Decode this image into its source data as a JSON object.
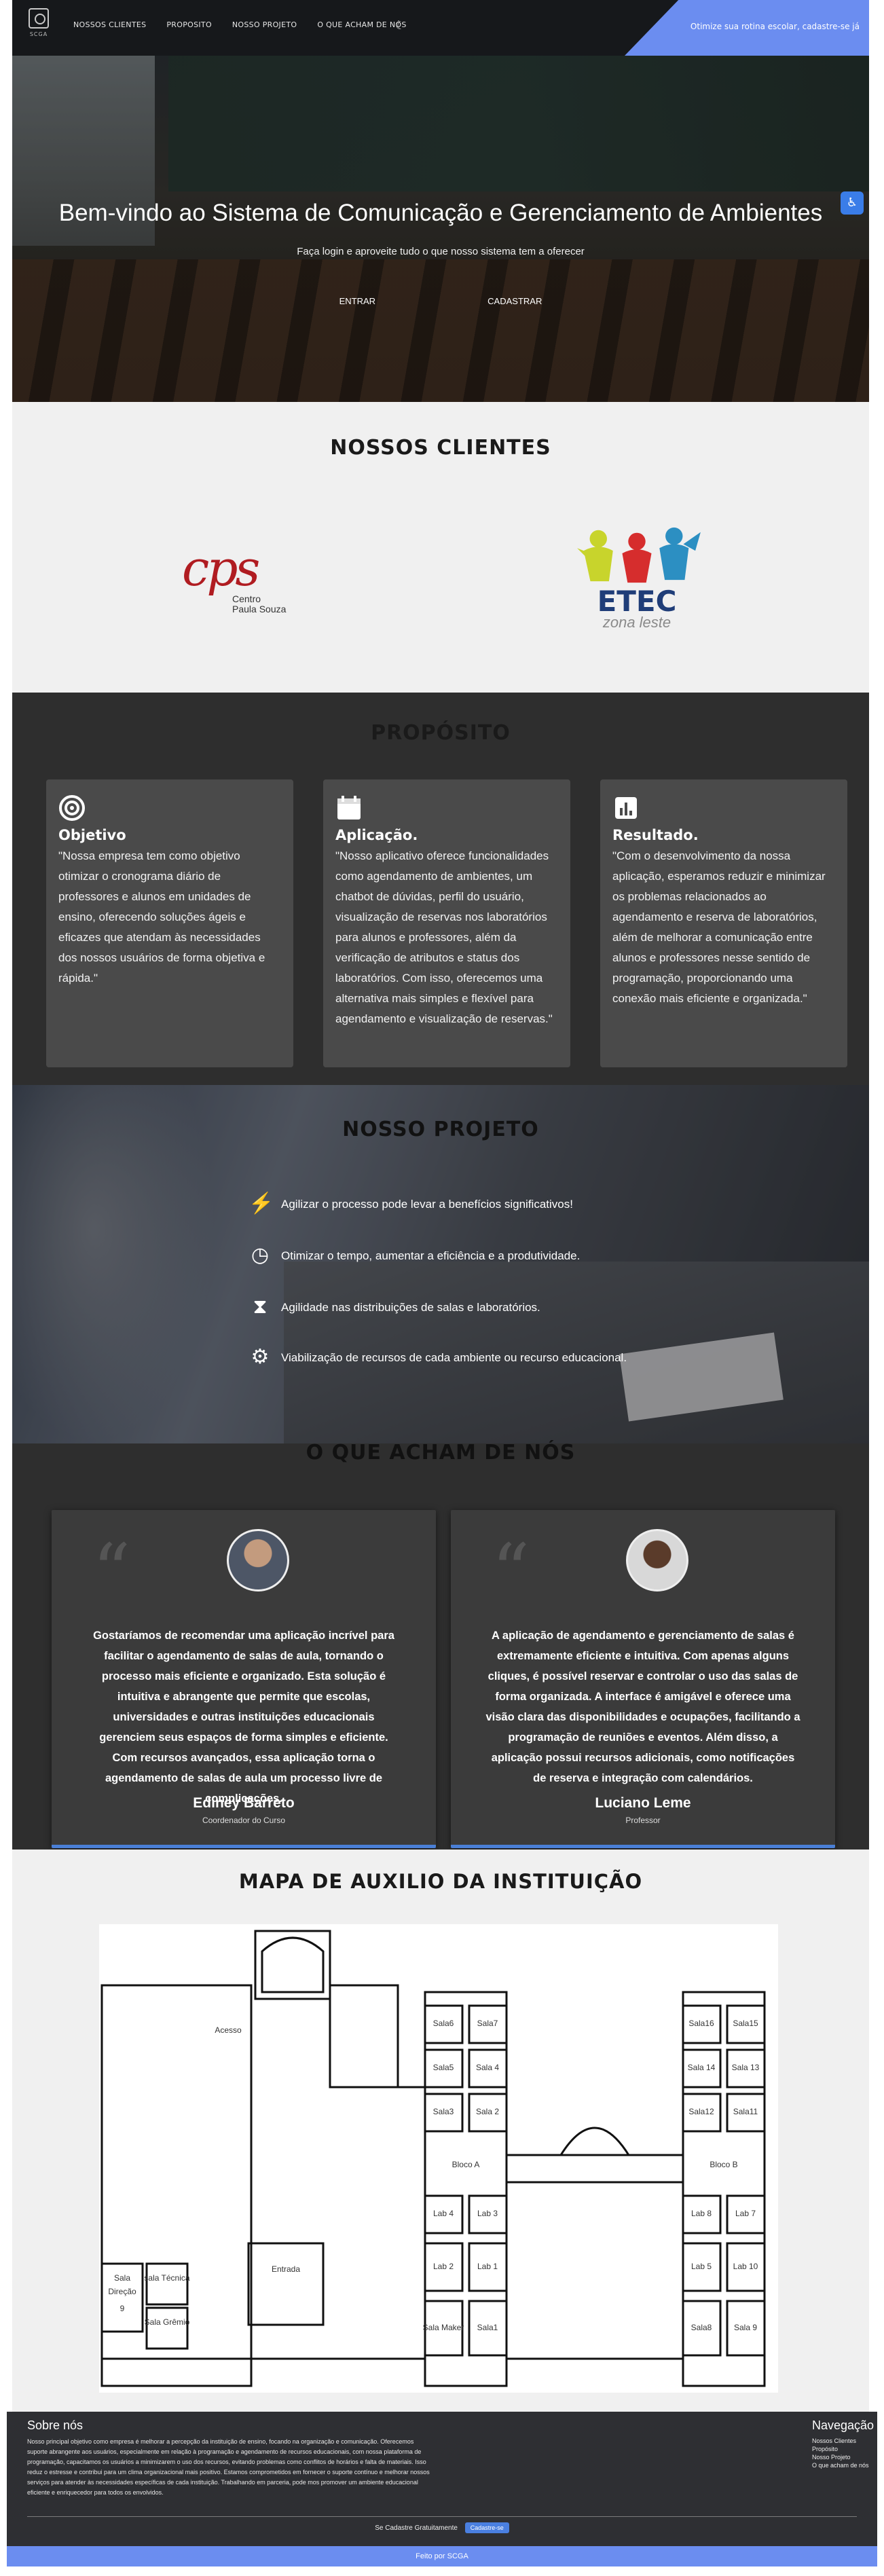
{
  "nav": {
    "logo_text": "SCGA",
    "links": [
      "NOSSOS CLIENTES",
      "PROPOSITO",
      "NOSSO PROJETO",
      "O QUE ACHAM DE NÓS"
    ],
    "cta": "Otimize sua rotina escolar, cadastre-se já"
  },
  "hero": {
    "title": "Bem-vindo ao Sistema de Comunicação e Gerenciamento de Ambientes",
    "subtitle": "Faça login e aproveite tudo o que nosso sistema tem a oferecer",
    "login_label": "ENTRAR",
    "signup_label": "CADASTRAR"
  },
  "clients": {
    "heading": "NOSSOS CLIENTES",
    "cps": {
      "mark": "cps",
      "line1": "Centro",
      "line2": "Paula Souza"
    },
    "etec": {
      "mark": "ETEC",
      "sub": "zona leste"
    }
  },
  "purpose": {
    "heading": "PROPÓSITO",
    "cards": [
      {
        "icon": "target-icon",
        "title": "Objetivo",
        "text": "\"Nossa empresa tem como objetivo otimizar o cronograma diário de professores e alunos em unidades de ensino, oferecendo soluções ágeis e eficazes que atendam às necessidades dos nossos usuários de forma objetiva e rápida.\""
      },
      {
        "icon": "calendar-icon",
        "title": "Aplicação.",
        "text": "\"Nosso aplicativo oferece funcionalidades como agendamento de ambientes, um chatbot de dúvidas, perfil do usuário, visualização de reservas nos laboratórios para alunos e professores, além da verificação de atributos e status dos laboratórios. Com isso, oferecemos uma alternativa mais simples e flexível para agendamento e visualização de reservas.\""
      },
      {
        "icon": "bar-chart-icon",
        "title": "Resultado.",
        "text": "\"Com o desenvolvimento da nossa aplicação, esperamos reduzir e minimizar os problemas relacionados ao agendamento e reserva de laboratórios, além de melhorar a comunicação entre alunos e professores nesse sentido de programação, proporcionando uma conexão mais eficiente e organizada.\""
      }
    ]
  },
  "project": {
    "heading": "NOSSO PROJETO",
    "items": [
      {
        "icon": "bolt-icon",
        "text": "Agilizar o processo pode levar a benefícios significativos!"
      },
      {
        "icon": "clock-icon",
        "text": "Otimizar o tempo, aumentar a eficiência e a produtividade."
      },
      {
        "icon": "hourglass-icon",
        "text": "Agilidade nas distribuições de salas e laboratórios."
      },
      {
        "icon": "gear-icon",
        "text": "Viabilização de recursos de cada ambiente ou recurso educacional."
      }
    ]
  },
  "testimonials": {
    "heading": "O QUE ACHAM DE NÓS",
    "items": [
      {
        "text": "Gostaríamos de recomendar uma aplicação incrível para facilitar o agendamento de salas de aula, tornando o processo mais eficiente e organizado. Esta solução é intuitiva e abrangente que permite que escolas, universidades e outras instituições educacionais gerenciem seus espaços de forma simples e eficiente. Com recursos avançados, essa aplicação torna o agendamento de salas de aula um processo livre de complicações.",
        "name": "Ediney Barreto",
        "role": "Coordenador do Curso"
      },
      {
        "text": "A aplicação de agendamento e gerenciamento de salas é extremamente eficiente e intuitiva. Com apenas alguns cliques, é possível reservar e controlar o uso das salas de forma organizada. A interface é amigável e oferece uma visão clara das disponibilidades e ocupações, facilitando a programação de reuniões e eventos. Além disso, a aplicação possui recursos adicionais, como notificações de reserva e integração com calendários.",
        "name": "Luciano Leme",
        "role": "Professor"
      }
    ]
  },
  "map": {
    "heading": "MAPA DE AUXILIO DA INSTITUIÇÃO",
    "labels": [
      "Acesso",
      "Sala6",
      "Sala7",
      "Sala5",
      "Sala 4",
      "Sala3",
      "Sala 2",
      "Bloco A",
      "Lab 4",
      "Lab 3",
      "Lab 2",
      "Lab 1",
      "Sala Maker",
      "Sala1",
      "Sala16",
      "Sala15",
      "Sala 14",
      "Sala 13",
      "Sala12",
      "Sala11",
      "Bloco B",
      "Lab 8",
      "Lab 7",
      "Lab 5",
      "Lab 10",
      "Sala8",
      "Sala 9",
      "Entrada",
      "sala Técnica",
      "Sala Grêmio",
      "Sala",
      "Direção",
      "9"
    ]
  },
  "footer": {
    "about_title": "Sobre nós",
    "about_text": "Nosso principal objetivo como empresa é melhorar a percepção da instituição de ensino, focando na organização e comunicação. Oferecemos suporte abrangente aos usuários, especialmente em relação à programação e agendamento de recursos educacionais, com nossa plataforma de programação, capacitamos os usuários a minimizarem o uso dos recursos, evitando problemas como conflitos de horários e falta de materiais. Isso reduz o estresse e contribui para um clima organizacional mais positivo. Estamos comprometidos em fornecer o suporte contínuo e melhorar nossos serviços para atender às necessidades específicas de cada instituição. Trabalhando em parceria, pode mos promover um ambiente educacional eficiente e enriquecedor para todos os envolvidos.",
    "nav_title": "Navegação",
    "nav_links": [
      "Nossos Clientes",
      "Propósito",
      "Nosso Projeto",
      "O que acham de nós"
    ],
    "signup_text": "Se Cadastre Gratuitamente",
    "signup_btn": "Cadastre-se",
    "credit": "Feito por SCGA"
  },
  "colors": {
    "accent": "#6b8df0",
    "dark": "#2e2e2e",
    "card": "#4a4a4a",
    "light": "#f0f0f0",
    "cps_red": "#b01c21",
    "etec_blue": "#1f3d78"
  }
}
